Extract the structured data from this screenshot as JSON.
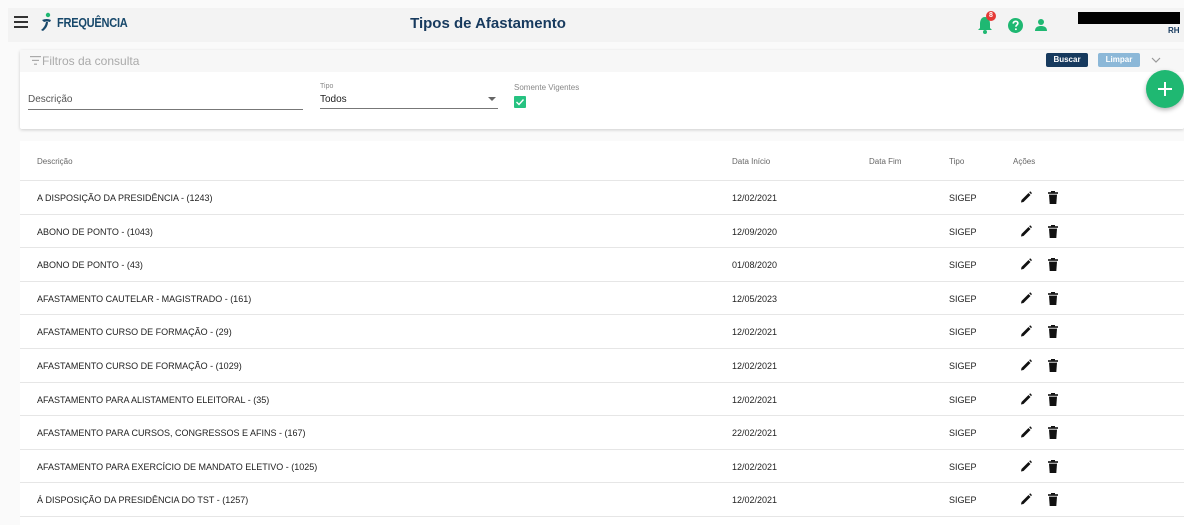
{
  "header": {
    "brand": "FREQUÊNCIA",
    "title": "Tipos de Afastamento",
    "notification_count": "8",
    "user_role": "RH"
  },
  "filters": {
    "title": "Filtros da consulta",
    "buscar_label": "Buscar",
    "limpar_label": "Limpar",
    "descricao_placeholder": "Descrição",
    "tipo_label": "Tipo",
    "tipo_value": "Todos",
    "vigentes_label": "Somente Vigentes",
    "vigentes_checked": true
  },
  "table": {
    "columns": {
      "descricao": "Descrição",
      "data_inicio": "Data Início",
      "data_fim": "Data Fim",
      "tipo": "Tipo",
      "acoes": "Ações"
    },
    "rows": [
      {
        "descricao": "A DISPOSIÇÃO DA PRESIDÊNCIA - (1243)",
        "data_inicio": "12/02/2021",
        "data_fim": "",
        "tipo": "SIGEP"
      },
      {
        "descricao": "ABONO DE PONTO - (1043)",
        "data_inicio": "12/09/2020",
        "data_fim": "",
        "tipo": "SIGEP"
      },
      {
        "descricao": "ABONO DE PONTO - (43)",
        "data_inicio": "01/08/2020",
        "data_fim": "",
        "tipo": "SIGEP"
      },
      {
        "descricao": "AFASTAMENTO CAUTELAR - MAGISTRADO - (161)",
        "data_inicio": "12/05/2023",
        "data_fim": "",
        "tipo": "SIGEP"
      },
      {
        "descricao": "AFASTAMENTO CURSO DE FORMAÇÃO - (29)",
        "data_inicio": "12/02/2021",
        "data_fim": "",
        "tipo": "SIGEP"
      },
      {
        "descricao": "AFASTAMENTO CURSO DE FORMAÇÃO - (1029)",
        "data_inicio": "12/02/2021",
        "data_fim": "",
        "tipo": "SIGEP"
      },
      {
        "descricao": "AFASTAMENTO PARA ALISTAMENTO ELEITORAL - (35)",
        "data_inicio": "12/02/2021",
        "data_fim": "",
        "tipo": "SIGEP"
      },
      {
        "descricao": "AFASTAMENTO PARA CURSOS, CONGRESSOS E AFINS - (167)",
        "data_inicio": "22/02/2021",
        "data_fim": "",
        "tipo": "SIGEP"
      },
      {
        "descricao": "AFASTAMENTO PARA EXERCÍCIO DE MANDATO ELETIVO - (1025)",
        "data_inicio": "12/02/2021",
        "data_fim": "",
        "tipo": "SIGEP"
      },
      {
        "descricao": "Á DISPOSIÇÃO DA PRESIDÊNCIA DO TST - (1257)",
        "data_inicio": "12/02/2021",
        "data_fim": "",
        "tipo": "SIGEP"
      }
    ]
  },
  "icons": {
    "menu": "hamburger-icon",
    "notification": "bell-icon",
    "help": "help-icon",
    "user": "user-icon",
    "filter": "filter-icon",
    "add": "plus-icon",
    "edit": "pencil-icon",
    "delete": "trash-icon"
  },
  "colors": {
    "primary": "#173a5e",
    "secondary": "#8cb8d8",
    "accent": "#1fb872",
    "badge": "#e53935"
  }
}
